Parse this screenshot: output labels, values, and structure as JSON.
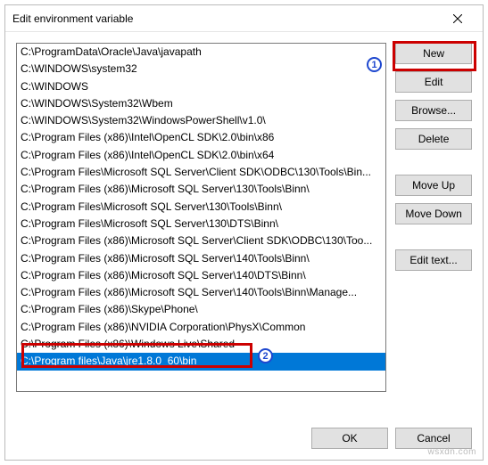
{
  "dialog": {
    "title": "Edit environment variable"
  },
  "list": {
    "items": [
      "C:\\ProgramData\\Oracle\\Java\\javapath",
      "C:\\WINDOWS\\system32",
      "C:\\WINDOWS",
      "C:\\WINDOWS\\System32\\Wbem",
      "C:\\WINDOWS\\System32\\WindowsPowerShell\\v1.0\\",
      "C:\\Program Files (x86)\\Intel\\OpenCL SDK\\2.0\\bin\\x86",
      "C:\\Program Files (x86)\\Intel\\OpenCL SDK\\2.0\\bin\\x64",
      "C:\\Program Files\\Microsoft SQL Server\\Client SDK\\ODBC\\130\\Tools\\Bin...",
      "C:\\Program Files (x86)\\Microsoft SQL Server\\130\\Tools\\Binn\\",
      "C:\\Program Files\\Microsoft SQL Server\\130\\Tools\\Binn\\",
      "C:\\Program Files\\Microsoft SQL Server\\130\\DTS\\Binn\\",
      "C:\\Program Files (x86)\\Microsoft SQL Server\\Client SDK\\ODBC\\130\\Too...",
      "C:\\Program Files (x86)\\Microsoft SQL Server\\140\\Tools\\Binn\\",
      "C:\\Program Files (x86)\\Microsoft SQL Server\\140\\DTS\\Binn\\",
      "C:\\Program Files (x86)\\Microsoft SQL Server\\140\\Tools\\Binn\\Manage...",
      "C:\\Program Files (x86)\\Skype\\Phone\\",
      "C:\\Program Files (x86)\\NVIDIA Corporation\\PhysX\\Common",
      "C:\\Program Files (x86)\\Windows Live\\Shared",
      "C:\\Program files\\Java\\jre1.8.0_60\\bin"
    ],
    "selected_index": 18
  },
  "buttons": {
    "new": "New",
    "edit": "Edit",
    "browse": "Browse...",
    "delete": "Delete",
    "move_up": "Move Up",
    "move_down": "Move Down",
    "edit_text": "Edit text...",
    "ok": "OK",
    "cancel": "Cancel"
  },
  "badges": {
    "one": "1",
    "two": "2"
  },
  "watermark": "wsxdn.com"
}
